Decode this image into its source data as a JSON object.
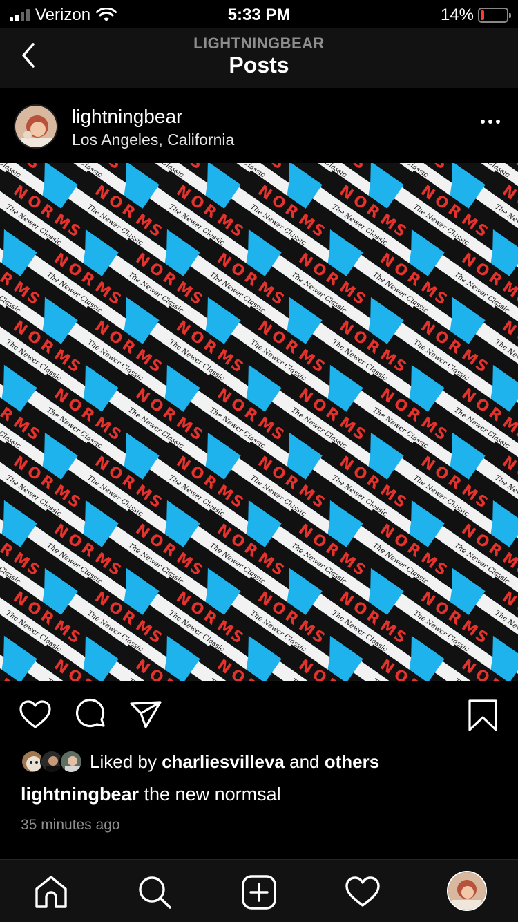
{
  "status_bar": {
    "carrier": "Verizon",
    "time": "5:33 PM",
    "battery_percent": "14%",
    "battery_level": 0.14,
    "battery_color": "#ff3b30"
  },
  "nav": {
    "subtitle": "LIGHTNINGBEAR",
    "title": "Posts",
    "back_icon": "chevron-left-icon"
  },
  "post": {
    "username": "lightningbear",
    "location": "Los Angeles, California",
    "image_sign_letters": [
      "N",
      "O",
      "R",
      "M",
      "S"
    ],
    "image_script_text": "The Newer Classic",
    "colors": {
      "sky": "#1fb3ee",
      "sign_red": "#e5322d",
      "sign_black": "#111111",
      "sign_white": "#f2f2f2"
    }
  },
  "actions": {
    "icons": [
      "heart-icon",
      "comment-icon",
      "share-icon",
      "bookmark-icon"
    ]
  },
  "likes": {
    "prefix": "Liked by",
    "user": "charliesvilleva",
    "middle": "and",
    "suffix": "others"
  },
  "caption": {
    "username": "lightningbear",
    "text": "the new normsal"
  },
  "time_ago": "35 minutes ago",
  "tabbar": {
    "icons": [
      "home-icon",
      "search-icon",
      "new-post-icon",
      "activity-heart-icon",
      "profile-avatar"
    ]
  }
}
